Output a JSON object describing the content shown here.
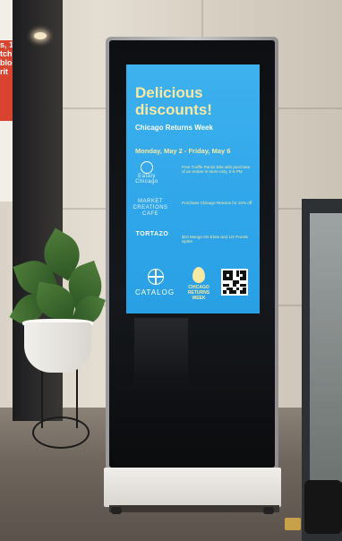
{
  "poster": {
    "text": "s, 1\ntch, W\nblog\nrit"
  },
  "screen": {
    "headline": "Delicious discounts!",
    "subtitle": "Chicago Returns Week",
    "dates": "Monday, May 2 - Friday, May 6",
    "logos": [
      {
        "label": "Eataly Chicago",
        "icon": "circle-logo"
      },
      {
        "label": "MARKET CREATIONS CAFE",
        "icon": "text-logo"
      },
      {
        "label": "TORTAZO",
        "icon": "text-logo"
      }
    ],
    "offers": [
      "Free Truffle Panini Bite with purchase of an entree in store only, 2-5 PM",
      "Purchase Chicago Returns for 10% off",
      "$10 Mango Iris Elote and 1/2 Pozole Sprite"
    ],
    "footer": {
      "catalog_label": "CATALOG",
      "week_label": "CHICAGO RETURNS WEEK",
      "qr_icon": "qr-code-icon"
    },
    "colors": {
      "background": "#34abeb",
      "accent": "#f6e9a4"
    }
  }
}
